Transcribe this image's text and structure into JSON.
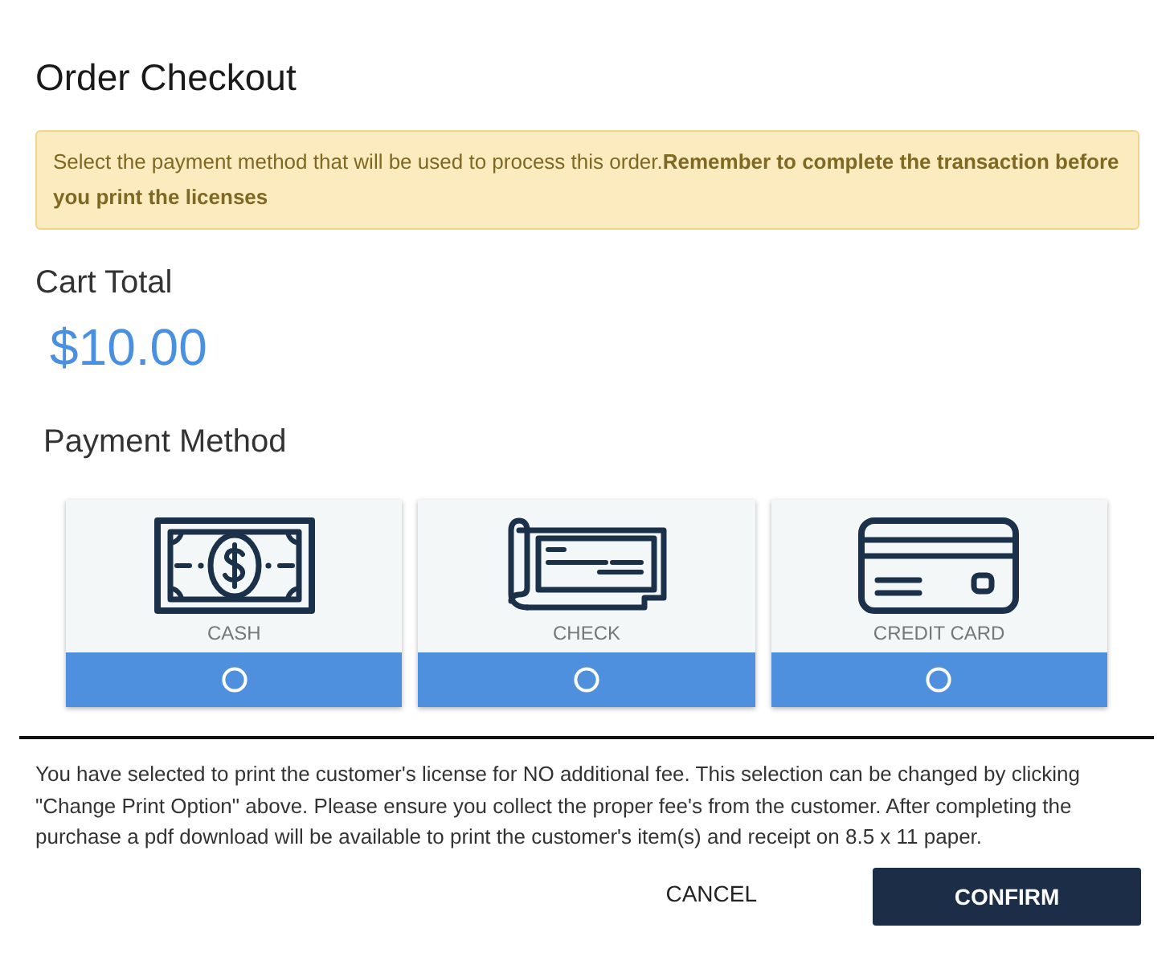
{
  "dialog": {
    "title": "Order Checkout"
  },
  "alert": {
    "text": "Select the payment method that will be used to process this order.**Remember to complete the transaction before you print the licenses**"
  },
  "cart_total": {
    "label": "Cart Total",
    "amount": "$10.00"
  },
  "payment": {
    "heading": "Payment Method",
    "methods": [
      {
        "kind": "cash",
        "label": "CASH",
        "selected": false
      },
      {
        "kind": "check",
        "label": "CHECK",
        "selected": false
      },
      {
        "kind": "card",
        "label": "CREDIT CARD",
        "selected": false
      }
    ]
  },
  "notice": "You have selected to print the customer's license for NO additional fee. This selection can be changed by clicking \"Change Print Option\" above. Please ensure you collect the proper fee's from the customer. After completing the purchase a pdf download will be available to print the customer's item(s) and receipt on 8.5 x 11 paper.",
  "buttons": [
    {
      "kind": "text",
      "label": "CANCEL"
    },
    {
      "kind": "primary",
      "label": "CONFIRM"
    }
  ]
}
